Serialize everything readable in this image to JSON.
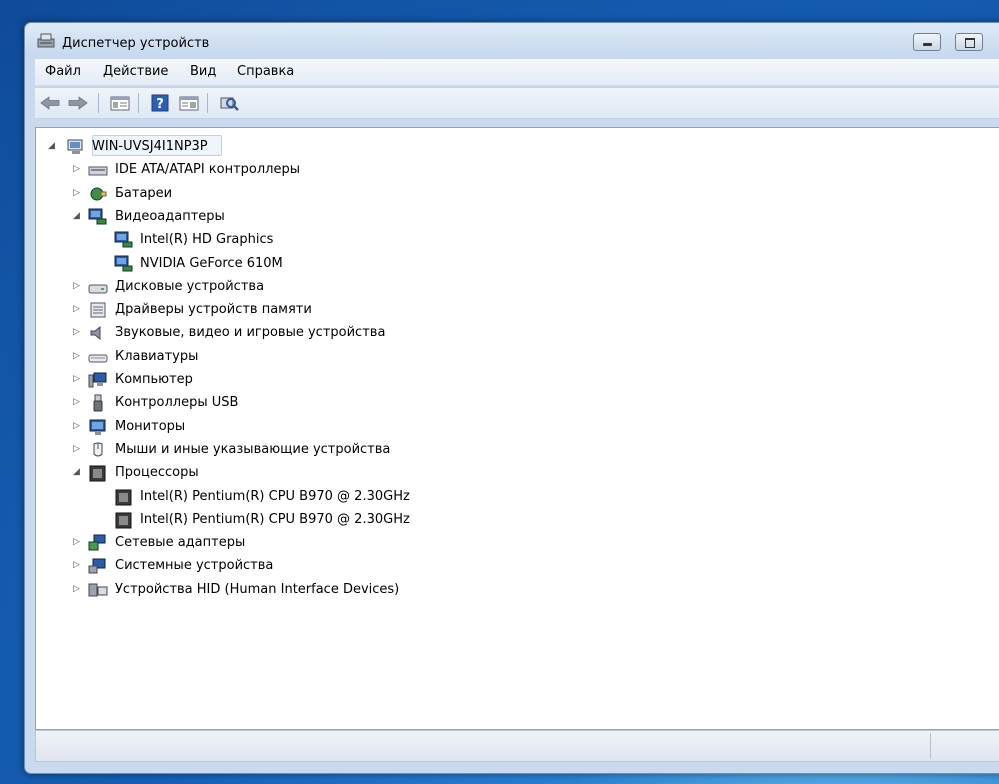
{
  "window": {
    "title": "Диспетчер устройств"
  },
  "menu": [
    {
      "label": "Файл"
    },
    {
      "label": "Действие"
    },
    {
      "label": "Вид"
    },
    {
      "label": "Справка"
    }
  ],
  "toolbar": [
    {
      "icon": "back-arrow-icon"
    },
    {
      "icon": "forward-arrow-icon"
    },
    {
      "icon": "show-hide-console-tree-icon"
    },
    {
      "icon": "help-icon"
    },
    {
      "icon": "properties-icon"
    },
    {
      "icon": "scan-hardware-icon"
    }
  ],
  "tree": {
    "root": "WIN-UVSJ4I1NP3P",
    "items": [
      {
        "label": "IDE ATA/ATAPI контроллеры",
        "state": "collapsed",
        "icon": "ide-controller-icon"
      },
      {
        "label": "Батареи",
        "state": "collapsed",
        "icon": "battery-icon"
      },
      {
        "label": "Видеоадаптеры",
        "state": "expanded",
        "icon": "display-adapter-icon",
        "children": [
          {
            "label": "Intel(R) HD Graphics",
            "icon": "display-adapter-icon"
          },
          {
            "label": "NVIDIA GeForce 610M",
            "icon": "display-adapter-icon"
          }
        ]
      },
      {
        "label": "Дисковые устройства",
        "state": "collapsed",
        "icon": "disk-drive-icon"
      },
      {
        "label": "Драйверы устройств памяти",
        "state": "collapsed",
        "icon": "memory-device-icon"
      },
      {
        "label": "Звуковые, видео и игровые устройства",
        "state": "collapsed",
        "icon": "speaker-icon"
      },
      {
        "label": "Клавиатуры",
        "state": "collapsed",
        "icon": "keyboard-icon"
      },
      {
        "label": "Компьютер",
        "state": "collapsed",
        "icon": "computer-icon"
      },
      {
        "label": "Контроллеры USB",
        "state": "collapsed",
        "icon": "usb-icon"
      },
      {
        "label": "Мониторы",
        "state": "collapsed",
        "icon": "monitor-icon"
      },
      {
        "label": "Мыши и иные указывающие устройства",
        "state": "collapsed",
        "icon": "mouse-icon"
      },
      {
        "label": "Процессоры",
        "state": "expanded",
        "icon": "processor-icon",
        "children": [
          {
            "label": "Intel(R) Pentium(R) CPU B970 @ 2.30GHz",
            "icon": "processor-icon"
          },
          {
            "label": "Intel(R) Pentium(R) CPU B970 @ 2.30GHz",
            "icon": "processor-icon"
          }
        ]
      },
      {
        "label": "Сетевые адаптеры",
        "state": "collapsed",
        "icon": "network-adapter-icon"
      },
      {
        "label": "Системные устройства",
        "state": "collapsed",
        "icon": "system-device-icon"
      },
      {
        "label": "Устройства HID (Human Interface Devices)",
        "state": "collapsed",
        "icon": "hid-device-icon"
      }
    ]
  },
  "colors": {
    "desktop": "#1762b8",
    "window_frame": "#c9daee",
    "root_highlight": "#eef5fc"
  }
}
